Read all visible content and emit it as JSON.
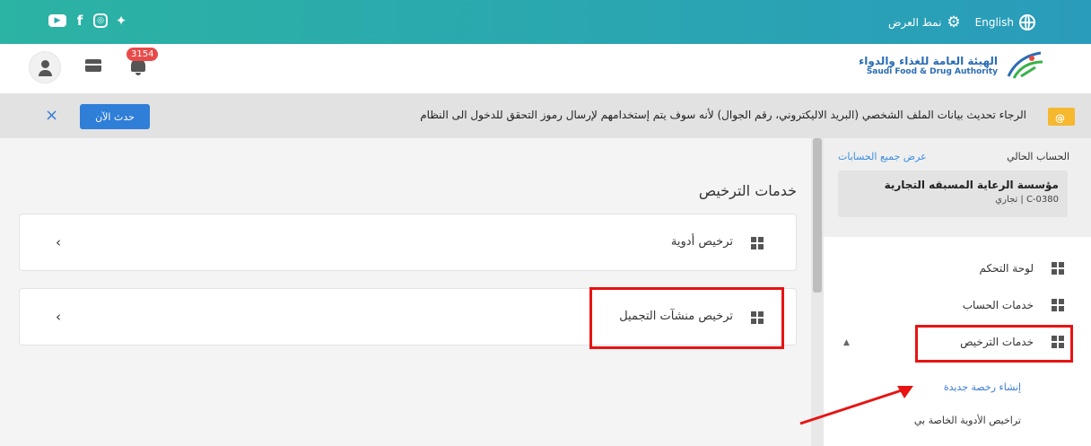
{
  "topbar": {
    "social_icons": [
      "youtube-icon",
      "facebook-icon",
      "instagram-icon",
      "twitter-icon"
    ],
    "display_mode_label": "نمط العرض",
    "language_label": "English",
    "colors": {
      "gradient_start": "#2bb3a3",
      "gradient_end": "#2a9cbb"
    }
  },
  "header": {
    "notification_count": "3154",
    "logo": {
      "arabic": "الهيئة العامة للغذاء والدواء",
      "english": "Saudi Food & Drug Authority"
    }
  },
  "notice": {
    "text": "الرجاء تحديث بيانات الملف الشخصي (البريد الاليكتروني، رقم الجوال) لأنه سوف يتم إستخدامهم لإرسال رموز التحقق للدخول الى النظام",
    "update_button": "حدث الآن",
    "close_icon": "×"
  },
  "main": {
    "section_title": "خدمات الترخيص",
    "cards": [
      {
        "label": "ترخيص أدوية",
        "chevron": "‹"
      },
      {
        "label": "ترخيص منشآت التجميل",
        "chevron": "‹"
      }
    ]
  },
  "sidebar": {
    "current_account_label": "الحساب الحالي",
    "all_accounts_link": "عرض جميع الحسابات",
    "account_name": "مؤسسة الرعاية المسبقه التجارية",
    "account_sub": "C-0380 | تجاري",
    "menu": [
      {
        "label": "لوحة التحكم"
      },
      {
        "label": "خدمات الحساب"
      },
      {
        "label": "خدمات الترخيص",
        "expanded": true
      }
    ],
    "submenu": [
      {
        "label": "إنشاء رخصة جديدة",
        "color": "#3a7bd5"
      },
      {
        "label": "تراخيص الأدوية الخاصة بي",
        "color": "#333333"
      }
    ],
    "collapse_icon": "▲"
  },
  "annotation": {
    "highlight_color": "#e81313"
  }
}
